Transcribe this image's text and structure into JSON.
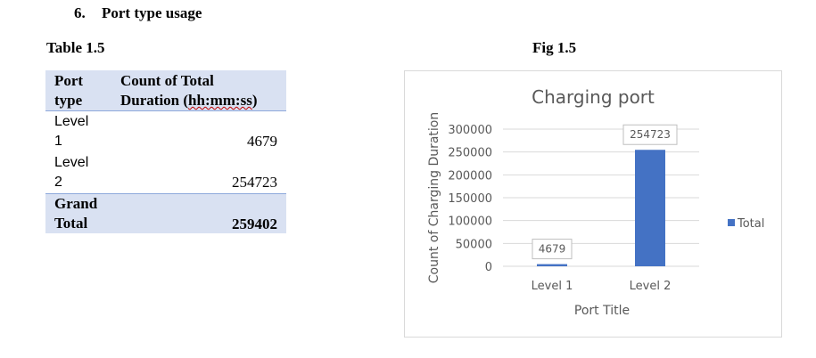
{
  "section_heading": {
    "number": "6.",
    "text": "Port type usage"
  },
  "table_caption": "Table 1.5",
  "figure_caption": "Fig 1.5",
  "table": {
    "header": {
      "col1": "Port type",
      "col2_line1": "Count of Total",
      "col2_prefix": "Duration (",
      "col2_underlined": "hh:mm:ss",
      "col2_suffix": ")"
    },
    "rows": [
      {
        "label_line1": "Level",
        "label_line2": "1",
        "value": "4679"
      },
      {
        "label_line1": "Level",
        "label_line2": "2",
        "value": "254723"
      }
    ],
    "total": {
      "label_line1": "Grand",
      "label_line2": "Total",
      "value": "259402"
    }
  },
  "chart_data": {
    "type": "bar",
    "title": "Charging port",
    "xlabel": "Port Title",
    "ylabel": "Count of Charging Duration",
    "categories": [
      "Level 1",
      "Level 2"
    ],
    "series": [
      {
        "name": "Total",
        "values": [
          4679,
          254723
        ]
      }
    ],
    "data_labels": [
      "4679",
      "254723"
    ],
    "ylim": [
      0,
      300000
    ],
    "yticks": [
      0,
      50000,
      100000,
      150000,
      200000,
      250000,
      300000
    ],
    "legend_position": "right",
    "grid": true,
    "colors": {
      "bar": "#4472c4",
      "grid": "#d9d9d9",
      "title": "#595959",
      "axis_text": "#595959"
    }
  }
}
